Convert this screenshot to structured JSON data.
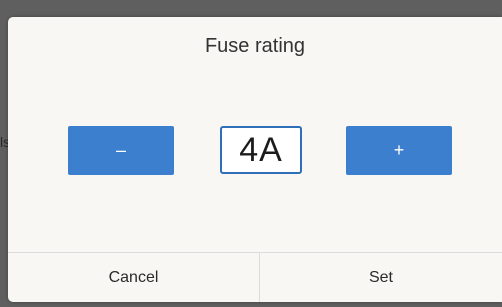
{
  "background": {
    "peek_text": "ls"
  },
  "dialog": {
    "title": "Fuse rating",
    "decrement_label": "–",
    "increment_label": "+",
    "value": "4A",
    "cancel_label": "Cancel",
    "confirm_label": "Set"
  },
  "colors": {
    "accent": "#3b7fce",
    "dialog_background": "#f8f7f4",
    "overlay": "#5f5f5f"
  }
}
